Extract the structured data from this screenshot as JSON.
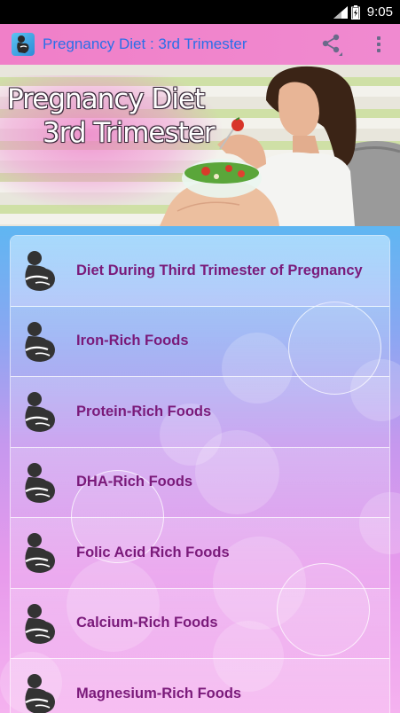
{
  "status_bar": {
    "time": "9:05"
  },
  "app_bar": {
    "title": "Pregnancy Diet : 3rd Trimester"
  },
  "banner": {
    "title_line1": "Pregnancy Diet",
    "title_line2": "3rd Trimester"
  },
  "menu": {
    "items": [
      {
        "label": "Diet During Third Trimester of Pregnancy"
      },
      {
        "label": "Iron-Rich Foods"
      },
      {
        "label": "Protein-Rich Foods"
      },
      {
        "label": "DHA-Rich Foods"
      },
      {
        "label": "Folic Acid Rich Foods"
      },
      {
        "label": "Calcium-Rich Foods"
      },
      {
        "label": "Magnesium-Rich Foods"
      }
    ]
  },
  "icons": {
    "status": [
      "wifi-signal-icon",
      "battery-icon"
    ],
    "app_bar": [
      "app-logo-icon",
      "share-icon",
      "overflow-menu-icon"
    ],
    "list_item": "pregnant-belly-icon"
  },
  "colors": {
    "app_bar": "#f07fc8",
    "title_text": "#2a6fe8",
    "item_text": "#7a1a7a",
    "icon_dark": "#333333"
  }
}
